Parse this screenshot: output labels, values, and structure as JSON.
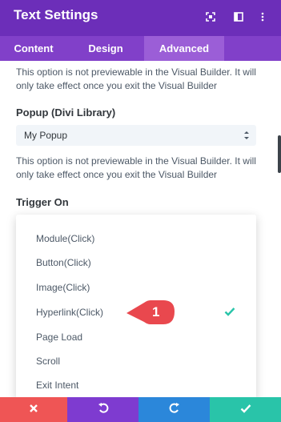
{
  "header": {
    "title": "Text Settings",
    "icons": [
      "expand-icon",
      "sidebar-layout-icon",
      "more-options-icon"
    ]
  },
  "tabs": [
    {
      "label": "Content",
      "active": false
    },
    {
      "label": "Design",
      "active": false
    },
    {
      "label": "Advanced",
      "active": true
    }
  ],
  "notice_text": "This option is not previewable in the Visual Builder. It will only take effect once you exit the Visual Builder",
  "popup_field": {
    "label": "Popup (Divi Library)",
    "value": "My Popup",
    "notice": "This option is not previewable in the Visual Builder. It will only take effect once you exit the Visual Builder"
  },
  "trigger_field": {
    "label": "Trigger On",
    "options": [
      {
        "label": "Module(Click)"
      },
      {
        "label": "Button(Click)"
      },
      {
        "label": "Image(Click)"
      },
      {
        "label": "Hyperlink(Click)",
        "selected": true
      },
      {
        "label": "Page Load"
      },
      {
        "label": "Scroll"
      },
      {
        "label": "Exit Intent"
      }
    ]
  },
  "callout_number": "1",
  "footer": {
    "buttons": [
      {
        "name": "discard",
        "icon": "close-icon",
        "color": "#ef5555"
      },
      {
        "name": "undo",
        "icon": "undo-icon",
        "color": "#7e3bd0"
      },
      {
        "name": "redo",
        "icon": "redo-icon",
        "color": "#2b87da"
      },
      {
        "name": "save",
        "icon": "check-icon",
        "color": "#29c4a9"
      }
    ]
  },
  "colors": {
    "header_bg": "#6c2eb9",
    "tabs_bg": "#8140c9",
    "active_tab_bg": "#9b5ed7",
    "check": "#29c4a9",
    "callout": "#e9484e"
  }
}
